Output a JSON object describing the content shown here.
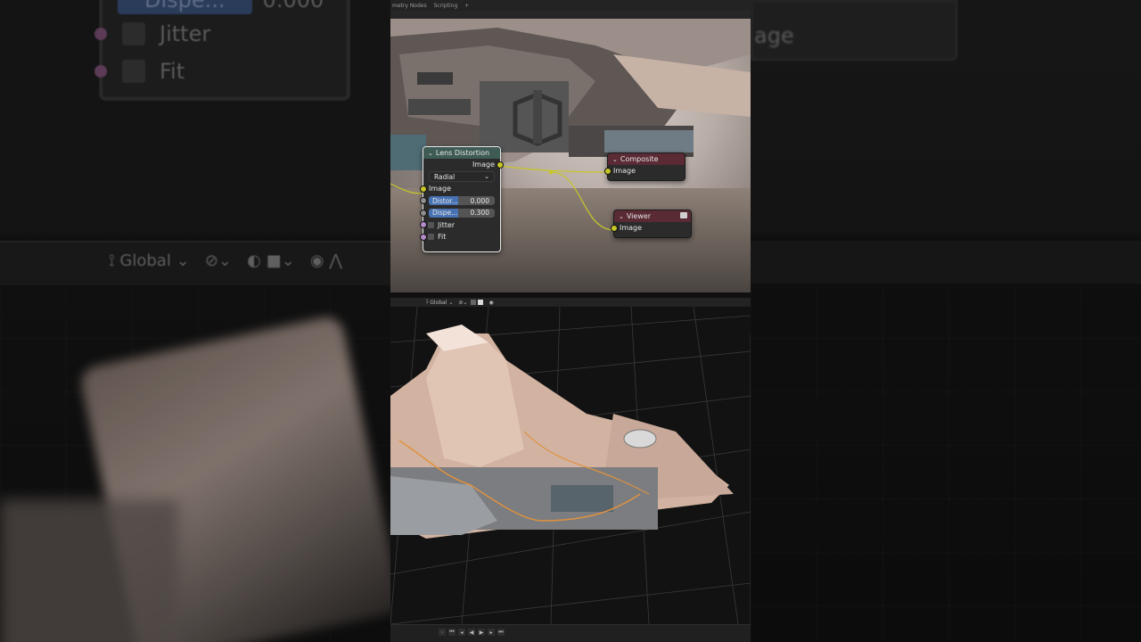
{
  "topbar": {
    "tabs": [
      "metry Nodes",
      "Scripting",
      "+"
    ]
  },
  "background_left": {
    "rows": [
      "Dispe...",
      "0.000",
      "Jitter",
      "Fit"
    ],
    "toolbar_label": "Global"
  },
  "background_right": {
    "text": "age"
  },
  "nodes": {
    "lens": {
      "title": "Lens Distortion",
      "output": "Image",
      "mode": "Radial",
      "input": "Image",
      "distortion_label": "Distor...",
      "distortion_value": "0.000",
      "distortion_fill": 0.0,
      "dispersion_label": "Dispe...",
      "dispersion_value": "0.300",
      "dispersion_fill": 0.3,
      "jitter_label": "Jitter",
      "fit_label": "Fit"
    },
    "composite": {
      "title": "Composite",
      "input": "Image"
    },
    "viewer": {
      "title": "Viewer",
      "input": "Image"
    }
  },
  "viewport": {
    "orientation_label": "Global"
  },
  "colors": {
    "accent_blue": "#4772b3",
    "socket_yellow": "#c7c729",
    "output_header": "#5a2a35",
    "converter_header": "#3e5b55",
    "selection_outline": "#e0923f"
  }
}
